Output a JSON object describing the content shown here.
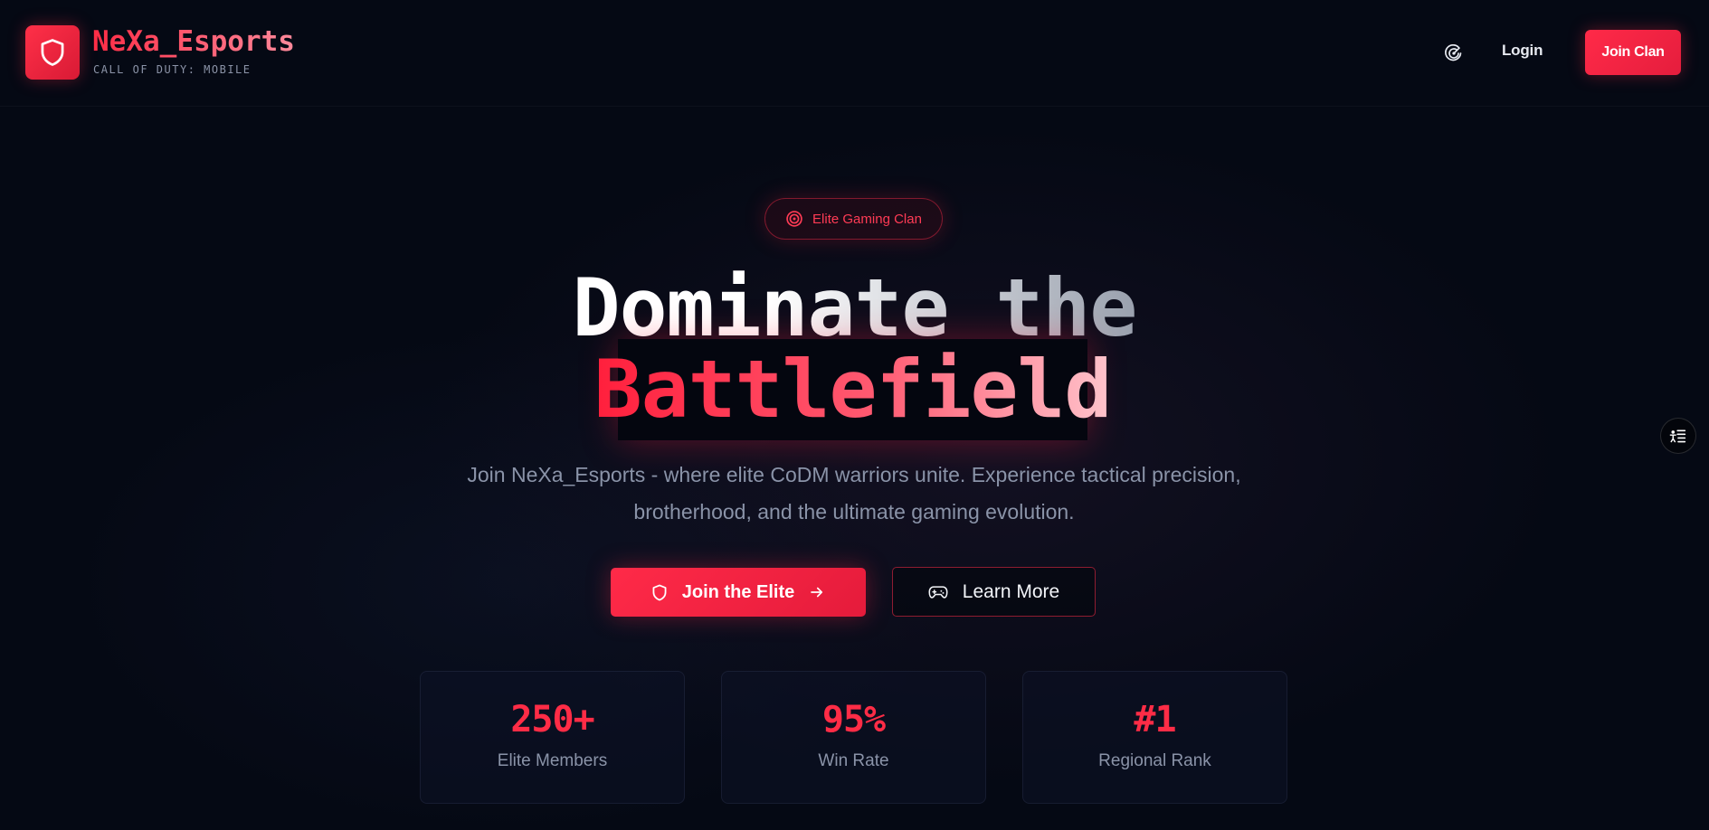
{
  "header": {
    "brand_name": "NeXa_Esports",
    "brand_sub": "CALL OF DUTY: MOBILE",
    "login_label": "Login",
    "join_clan_label": "Join Clan"
  },
  "hero": {
    "badge_label": "Elite Gaming Clan",
    "headline_line1": "Dominate the",
    "headline_line2": "Battlefield",
    "subtitle_line1": "Join NeXa_Esports - where elite CoDM warriors unite. Experience tactical precision,",
    "subtitle_line2": "brotherhood, and the ultimate gaming evolution.",
    "primary_cta": "Join the Elite",
    "secondary_cta": "Learn More"
  },
  "stats": [
    {
      "value": "250+",
      "label": "Elite Members"
    },
    {
      "value": "95%",
      "label": "Win Rate"
    },
    {
      "value": "#1",
      "label": "Regional Rank"
    }
  ],
  "icons": {
    "logo": "shield-icon",
    "theme": "radar-icon",
    "badge": "target-icon",
    "primary_cta_left": "shield-icon",
    "primary_cta_right": "arrow-right-icon",
    "secondary_cta_left": "gamepad-icon",
    "side_widget": "accessibility-menu-icon"
  },
  "colors": {
    "background": "#050914",
    "accent": "#ff2c46",
    "text_muted": "#8a93a8"
  }
}
